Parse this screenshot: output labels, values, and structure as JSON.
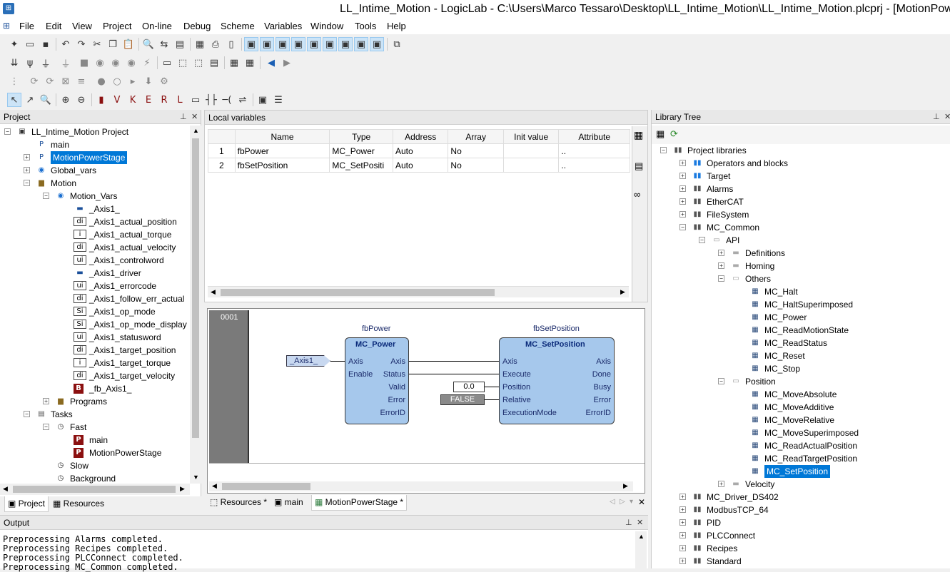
{
  "window": {
    "title": "LL_Intime_Motion - LogicLab - C:\\Users\\Marco Tessaro\\Desktop\\LL_Intime_Motion\\LL_Intime_Motion.plcprj - [MotionPowerStage *]"
  },
  "menu": [
    "File",
    "Edit",
    "View",
    "Project",
    "On-line",
    "Debug",
    "Scheme",
    "Variables",
    "Window",
    "Tools",
    "Help"
  ],
  "project_panel": {
    "title": "Project",
    "tree": [
      {
        "label": "LL_Intime_Motion Project",
        "level": 0,
        "icon": "project-icon",
        "expander": "-"
      },
      {
        "label": "main",
        "level": 1,
        "icon": "program-icon",
        "expander": ""
      },
      {
        "label": "MotionPowerStage",
        "level": 1,
        "icon": "program-icon",
        "expander": "+",
        "selected": true
      },
      {
        "label": "Global_vars",
        "level": 1,
        "icon": "globals-icon",
        "expander": "+"
      },
      {
        "label": "Motion",
        "level": 1,
        "icon": "folder-lock-icon",
        "expander": "-"
      },
      {
        "label": "Motion_Vars",
        "level": 2,
        "icon": "globals-icon",
        "expander": "-"
      },
      {
        "label": "_Axis1_",
        "level": 3,
        "icon": "struct-var-icon",
        "badge": ""
      },
      {
        "label": "_Axis1_actual_position",
        "level": 3,
        "icon": "var-icon",
        "badge": "di"
      },
      {
        "label": "_Axis1_actual_torque",
        "level": 3,
        "icon": "var-icon",
        "badge": "i"
      },
      {
        "label": "_Axis1_actual_velocity",
        "level": 3,
        "icon": "var-icon",
        "badge": "di"
      },
      {
        "label": "_Axis1_controlword",
        "level": 3,
        "icon": "var-icon",
        "badge": "ui"
      },
      {
        "label": "_Axis1_driver",
        "level": 3,
        "icon": "struct-var-icon",
        "badge": ""
      },
      {
        "label": "_Axis1_errorcode",
        "level": 3,
        "icon": "var-icon",
        "badge": "ui"
      },
      {
        "label": "_Axis1_follow_err_actual",
        "level": 3,
        "icon": "var-icon",
        "badge": "di"
      },
      {
        "label": "_Axis1_op_mode",
        "level": 3,
        "icon": "var-icon",
        "badge": "Si"
      },
      {
        "label": "_Axis1_op_mode_display",
        "level": 3,
        "icon": "var-icon",
        "badge": "Si"
      },
      {
        "label": "_Axis1_statusword",
        "level": 3,
        "icon": "var-icon",
        "badge": "ui"
      },
      {
        "label": "_Axis1_target_position",
        "level": 3,
        "icon": "var-icon",
        "badge": "di"
      },
      {
        "label": "_Axis1_target_torque",
        "level": 3,
        "icon": "var-icon",
        "badge": "i"
      },
      {
        "label": "_Axis1_target_velocity",
        "level": 3,
        "icon": "var-icon",
        "badge": "di"
      },
      {
        "label": "_fb_Axis1_",
        "level": 3,
        "icon": "fb-instance-icon",
        "badge": "B"
      },
      {
        "label": "Programs",
        "level": 2,
        "icon": "folder-lock-icon",
        "expander": "+"
      },
      {
        "label": "Tasks",
        "level": 1,
        "icon": "tasks-icon",
        "expander": "-"
      },
      {
        "label": "Fast",
        "level": 2,
        "icon": "clock-icon",
        "expander": "-"
      },
      {
        "label": "main",
        "level": 3,
        "icon": "program-red-icon",
        "badge": "P"
      },
      {
        "label": "MotionPowerStage",
        "level": 3,
        "icon": "program-red-icon",
        "badge": "P"
      },
      {
        "label": "Slow",
        "level": 2,
        "icon": "clock-icon",
        "expander": ""
      },
      {
        "label": "Background",
        "level": 2,
        "icon": "clock-icon",
        "expander": ""
      }
    ],
    "tabs": [
      "Project",
      "Resources"
    ]
  },
  "local_vars": {
    "title": "Local variables",
    "columns": [
      "",
      "Name",
      "Type",
      "Address",
      "Array",
      "Init value",
      "Attribute"
    ],
    "rows": [
      [
        "1",
        "fbPower",
        "MC_Power",
        "Auto",
        "No",
        "",
        ".."
      ],
      [
        "2",
        "fbSetPosition",
        "MC_SetPositi",
        "Auto",
        "No",
        "",
        ".."
      ]
    ]
  },
  "ladder": {
    "network": "0001",
    "block1": {
      "instance": "fbPower",
      "type": "MC_Power",
      "inputs": [
        "Axis",
        "Enable"
      ],
      "outputs": [
        "Axis",
        "Status",
        "Valid",
        "Error",
        "ErrorID"
      ]
    },
    "block2": {
      "instance": "fbSetPosition",
      "type": "MC_SetPosition",
      "inputs": [
        "Axis",
        "Execute",
        "Position",
        "Relative",
        "ExecutionMode"
      ],
      "outputs": [
        "Axis",
        "Done",
        "Busy",
        "Error",
        "ErrorID"
      ]
    },
    "axis_var": "_Axis1_",
    "position_const": "0.0",
    "relative_const": "FALSE"
  },
  "editor_tabs": [
    "Resources *",
    "main",
    "MotionPowerStage *"
  ],
  "output": {
    "title": "Output",
    "lines": [
      "Preprocessing Alarms completed.",
      "Preprocessing Recipes completed.",
      "Preprocessing PLCConnect completed.",
      "Preprocessing MC_Common completed."
    ]
  },
  "library": {
    "title": "Library Tree",
    "tree": [
      {
        "label": "Project libraries",
        "level": 0,
        "icon": "library-icon",
        "expander": "-"
      },
      {
        "label": "Operators and blocks",
        "level": 1,
        "icon": "library-blue-icon",
        "expander": "+"
      },
      {
        "label": "Target",
        "level": 1,
        "icon": "library-blue-icon",
        "expander": "+"
      },
      {
        "label": "Alarms",
        "level": 1,
        "icon": "library-icon",
        "expander": "+"
      },
      {
        "label": "EtherCAT",
        "level": 1,
        "icon": "library-icon",
        "expander": "+"
      },
      {
        "label": "FileSystem",
        "level": 1,
        "icon": "library-icon",
        "expander": "+"
      },
      {
        "label": "MC_Common",
        "level": 1,
        "icon": "library-icon",
        "expander": "-"
      },
      {
        "label": "API",
        "level": 2,
        "icon": "folder-open-icon",
        "expander": "-"
      },
      {
        "label": "Definitions",
        "level": 3,
        "icon": "folder-icon",
        "expander": "+"
      },
      {
        "label": "Homing",
        "level": 3,
        "icon": "folder-icon",
        "expander": "+"
      },
      {
        "label": "Others",
        "level": 3,
        "icon": "folder-open-icon",
        "expander": "-"
      },
      {
        "label": "MC_Halt",
        "level": 4,
        "icon": "fb-icon"
      },
      {
        "label": "MC_HaltSuperimposed",
        "level": 4,
        "icon": "fb-icon"
      },
      {
        "label": "MC_Power",
        "level": 4,
        "icon": "fb-icon"
      },
      {
        "label": "MC_ReadMotionState",
        "level": 4,
        "icon": "fb-icon"
      },
      {
        "label": "MC_ReadStatus",
        "level": 4,
        "icon": "fb-icon"
      },
      {
        "label": "MC_Reset",
        "level": 4,
        "icon": "fb-icon"
      },
      {
        "label": "MC_Stop",
        "level": 4,
        "icon": "fb-icon"
      },
      {
        "label": "Position",
        "level": 3,
        "icon": "folder-open-icon",
        "expander": "-"
      },
      {
        "label": "MC_MoveAbsolute",
        "level": 4,
        "icon": "fb-icon"
      },
      {
        "label": "MC_MoveAdditive",
        "level": 4,
        "icon": "fb-icon"
      },
      {
        "label": "MC_MoveRelative",
        "level": 4,
        "icon": "fb-icon"
      },
      {
        "label": "MC_MoveSuperimposed",
        "level": 4,
        "icon": "fb-icon"
      },
      {
        "label": "MC_ReadActualPosition",
        "level": 4,
        "icon": "fb-icon"
      },
      {
        "label": "MC_ReadTargetPosition",
        "level": 4,
        "icon": "fb-icon"
      },
      {
        "label": "MC_SetPosition",
        "level": 4,
        "icon": "fb-icon",
        "selected": true
      },
      {
        "label": "Velocity",
        "level": 3,
        "icon": "folder-icon",
        "expander": "+"
      },
      {
        "label": "MC_Driver_DS402",
        "level": 1,
        "icon": "library-icon",
        "expander": "+"
      },
      {
        "label": "ModbusTCP_64",
        "level": 1,
        "icon": "library-icon",
        "expander": "+"
      },
      {
        "label": "PID",
        "level": 1,
        "icon": "library-icon",
        "expander": "+"
      },
      {
        "label": "PLCConnect",
        "level": 1,
        "icon": "library-icon",
        "expander": "+"
      },
      {
        "label": "Recipes",
        "level": 1,
        "icon": "library-icon",
        "expander": "+"
      },
      {
        "label": "Standard",
        "level": 1,
        "icon": "library-icon",
        "expander": "+"
      }
    ]
  },
  "colors": {
    "selection": "#0078d7",
    "fb_fill": "#a6c8ec",
    "fb_title": "#0a2a7a"
  }
}
